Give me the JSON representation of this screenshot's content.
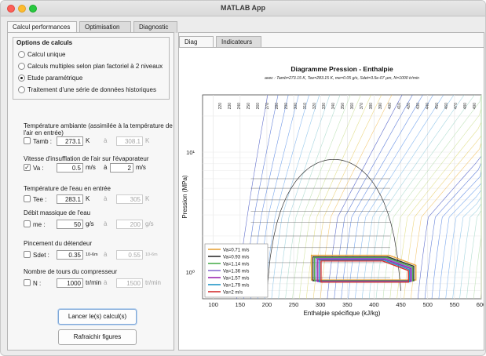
{
  "window": {
    "title": "MATLAB App"
  },
  "top_tabs": [
    "Calcul performances",
    "Optimisation",
    "Diagnostic"
  ],
  "options": {
    "title": "Options de calculs",
    "radios": [
      {
        "label": "Calcul unique",
        "selected": false
      },
      {
        "label": "Calculs multiples selon plan factoriel à 2 niveaux",
        "selected": false
      },
      {
        "label": "Etude paramétrique",
        "selected": true
      },
      {
        "label": "Traitement d'une série de données historiques",
        "selected": false
      }
    ]
  },
  "params": {
    "tamb": {
      "title": "Température ambiante (assimilée à la température de l'air en entrée)",
      "name": "Tamb :",
      "checked": false,
      "value": "273.1",
      "unit": "K",
      "to": "à",
      "value2": "308.1",
      "unit2": "K"
    },
    "va": {
      "title": "Vitesse d'insufflation de l'air sur l'évaporateur",
      "name": "Va :",
      "checked": true,
      "value": "0.5",
      "unit": "m/s",
      "to": "à",
      "value2": "2",
      "unit2": "m/s"
    },
    "tee": {
      "title": "Température de l'eau en entrée",
      "name": "Tee :",
      "checked": false,
      "value": "283.1",
      "unit": "K",
      "to": "à",
      "value2": "305",
      "unit2": "K"
    },
    "me": {
      "title": "Débit massique de l'eau",
      "name": "me :",
      "checked": false,
      "value": "50",
      "unit": "g/s",
      "to": "à",
      "value2": "200",
      "unit2": "g/s"
    },
    "sdet": {
      "title": "Pincement du détendeur",
      "name": "Sdet :",
      "checked": false,
      "value": "0.35",
      "unit": "10-6m",
      "to": "à",
      "value2": "0.55",
      "unit2": "10-6m"
    },
    "n": {
      "title": "Nombre de tours du compresseur",
      "name": "N :",
      "checked": false,
      "value": "1000",
      "unit": "tr/min",
      "to": "à",
      "value2": "1500",
      "unit2": "tr/min"
    }
  },
  "buttons": {
    "launch": "Lancer le(s) calcul(s)",
    "refresh": "Rafraichir figures"
  },
  "plot_tabs": [
    "Diag PHT",
    "Indicateurs"
  ],
  "chart_data": {
    "type": "line",
    "title": "Diagramme Pression - Enthalpie",
    "subtitle": "avec : Tamb=273.15 K, Tee=283.15 K, me=0.05 g/s, Sdet=3.5e-07 µm, N=1000 tr/min",
    "xlabel": "Enthalpie spécifique (kJ/kg)",
    "ylabel": "Pression (MPa)",
    "xlim": [
      80,
      600
    ],
    "ylim": [
      0.6,
      3
    ],
    "yscale": "log",
    "xticks": [
      "100",
      "150",
      "200",
      "250",
      "300",
      "350",
      "400",
      "450",
      "500",
      "550",
      "600"
    ],
    "yticks": [
      "10^0",
      "10^1"
    ],
    "grid": true,
    "legend_position": "bottom-left",
    "isotherm_labels": [
      "220",
      "230",
      "240",
      "250",
      "260",
      "270",
      "280",
      "290",
      "300",
      "310",
      "320",
      "330",
      "340",
      "350",
      "360",
      "370",
      "380",
      "390",
      "400",
      "410",
      "420",
      "430",
      "440",
      "450",
      "460",
      "470",
      "480",
      "490"
    ],
    "inner_labels": [
      "220",
      "240",
      "250",
      "270",
      "280",
      "290",
      "300",
      "310",
      "320",
      "330",
      "340",
      "350",
      "360",
      "370",
      "380",
      "390",
      "400",
      "410",
      "420",
      "430"
    ],
    "series": [
      {
        "name": "Va=0.71 m/s",
        "color": "#e8a33a",
        "points": [
          [
            283,
            1.38
          ],
          [
            428,
            1.38
          ],
          [
            478,
            1.14
          ],
          [
            478,
            1.14
          ],
          [
            478,
            0.86
          ],
          [
            283,
            0.86
          ]
        ]
      },
      {
        "name": "Va=0.93 m/s",
        "color": "#2e2e2e",
        "points": [
          [
            286,
            1.34
          ],
          [
            426,
            1.34
          ],
          [
            474,
            1.12
          ],
          [
            474,
            0.85
          ],
          [
            286,
            0.85
          ]
        ]
      },
      {
        "name": "Va=1.14 m/s",
        "color": "#4caf50",
        "points": [
          [
            289,
            1.32
          ],
          [
            424,
            1.32
          ],
          [
            472,
            1.1
          ],
          [
            472,
            0.845
          ],
          [
            289,
            0.845
          ]
        ]
      },
      {
        "name": "Va=1.36 m/s",
        "color": "#8a6fd1",
        "points": [
          [
            292,
            1.3
          ],
          [
            422,
            1.3
          ],
          [
            470,
            1.08
          ],
          [
            470,
            0.84
          ],
          [
            292,
            0.84
          ]
        ]
      },
      {
        "name": "Va=1.57 m/s",
        "color": "#9c27b0",
        "points": [
          [
            295,
            1.28
          ],
          [
            420,
            1.28
          ],
          [
            468,
            1.07
          ],
          [
            468,
            0.835
          ],
          [
            295,
            0.835
          ]
        ]
      },
      {
        "name": "Va=1.79 m/s",
        "color": "#2196c7",
        "points": [
          [
            298,
            1.26
          ],
          [
            418,
            1.26
          ],
          [
            466,
            1.05
          ],
          [
            466,
            0.83
          ],
          [
            298,
            0.83
          ]
        ]
      },
      {
        "name": "Va=2 m/s",
        "color": "#d32f2f",
        "points": [
          [
            301,
            1.24
          ],
          [
            416,
            1.24
          ],
          [
            464,
            1.03
          ],
          [
            464,
            0.825
          ],
          [
            301,
            0.825
          ]
        ]
      }
    ]
  }
}
